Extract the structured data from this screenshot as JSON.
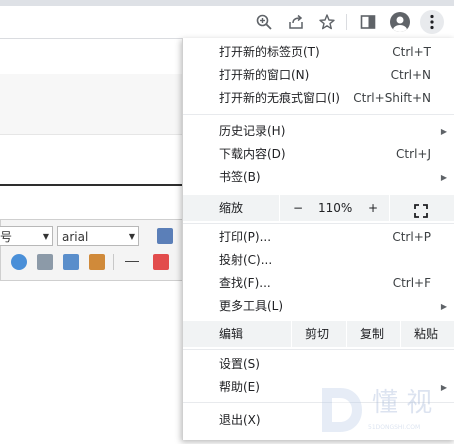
{
  "toolbar": {
    "icons": [
      "zoom-icon",
      "share-icon",
      "bookmark-star-icon",
      "side-panel-icon",
      "profile-icon",
      "more-menu-icon"
    ]
  },
  "editor": {
    "font_size_select": "号",
    "font_family_select": "arial"
  },
  "menu": {
    "new_tab": {
      "label": "打开新的标签页(T)",
      "shortcut": "Ctrl+T"
    },
    "new_window": {
      "label": "打开新的窗口(N)",
      "shortcut": "Ctrl+N"
    },
    "incognito": {
      "label": "打开新的无痕式窗口(I)",
      "shortcut": "Ctrl+Shift+N"
    },
    "history": {
      "label": "历史记录(H)"
    },
    "downloads": {
      "label": "下载内容(D)",
      "shortcut": "Ctrl+J"
    },
    "bookmarks": {
      "label": "书签(B)"
    },
    "zoom": {
      "label": "缩放",
      "minus": "−",
      "value": "110%",
      "plus": "+"
    },
    "print": {
      "label": "打印(P)...",
      "shortcut": "Ctrl+P"
    },
    "cast": {
      "label": "投射(C)..."
    },
    "find": {
      "label": "查找(F)...",
      "shortcut": "Ctrl+F"
    },
    "more_tools": {
      "label": "更多工具(L)"
    },
    "edit": {
      "label": "编辑",
      "cut": "剪切",
      "copy": "复制",
      "paste": "粘贴"
    },
    "settings": {
      "label": "设置(S)"
    },
    "help": {
      "label": "帮助(E)"
    },
    "exit": {
      "label": "退出(X)"
    }
  },
  "watermark": {
    "text": "懂 视",
    "sub": "51DONGSHI.COM"
  },
  "colors": {
    "menu_bg": "#ffffff",
    "row_bg": "#f1f3f4",
    "icon": "#5f6368",
    "text": "#202124"
  }
}
